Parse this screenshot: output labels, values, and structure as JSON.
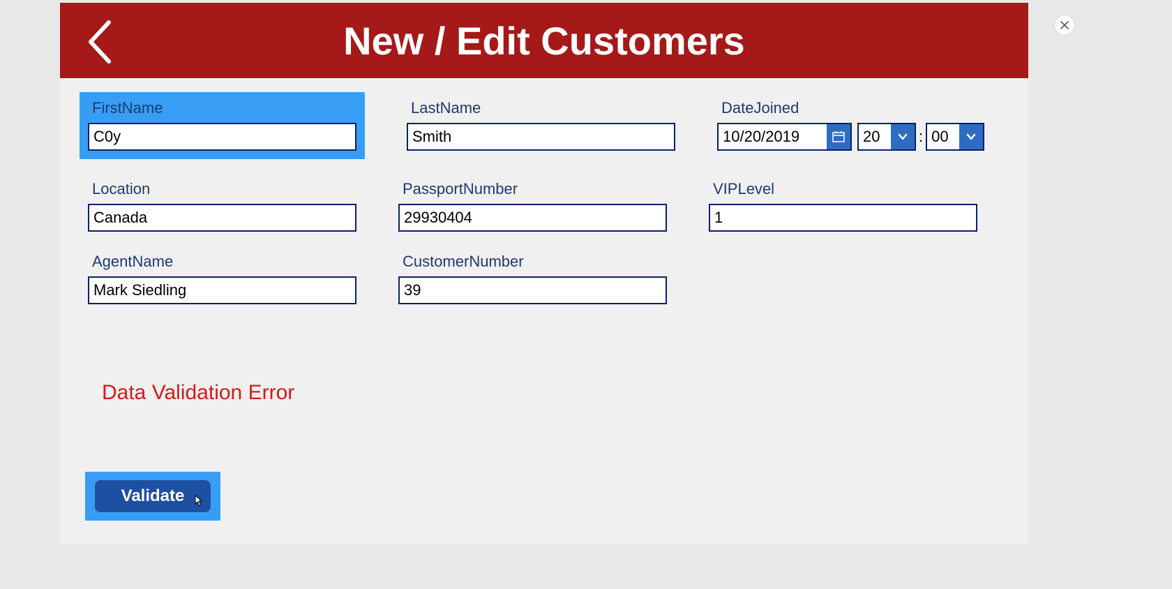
{
  "header": {
    "title": "New / Edit Customers"
  },
  "fields": {
    "firstName": {
      "label": "FirstName",
      "value": "C0y"
    },
    "lastName": {
      "label": "LastName",
      "value": "Smith"
    },
    "dateJoined": {
      "label": "DateJoined",
      "date": "10/20/2019",
      "hour": "20",
      "minute": "00",
      "separator": ":"
    },
    "location": {
      "label": "Location",
      "value": "Canada"
    },
    "passport": {
      "label": "PassportNumber",
      "value": "29930404"
    },
    "vipLevel": {
      "label": "VIPLevel",
      "value": "1"
    },
    "agentName": {
      "label": "AgentName",
      "value": "Mark Siedling"
    },
    "customerNumber": {
      "label": "CustomerNumber",
      "value": "39"
    }
  },
  "status": {
    "errorText": "Data Validation Error"
  },
  "actions": {
    "validate": "Validate"
  }
}
